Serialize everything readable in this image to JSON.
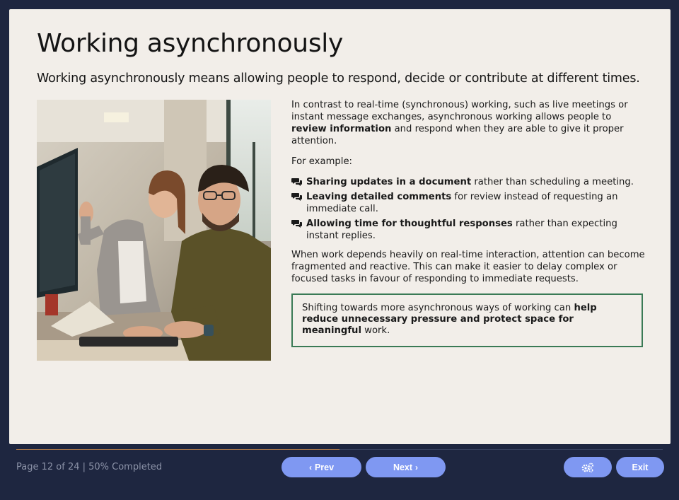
{
  "slide": {
    "title": "Working asynchronously",
    "subtitle": "Working asynchronously means allowing people to respond, decide or contribute at different times.",
    "photo_alt": "Two colleagues working together at a computer",
    "intro": {
      "pre": "In contrast to real-time (synchronous) working, such as live meetings or instant message exchanges, asynchronous working allows people to ",
      "bold": "review information",
      "post": " and respond when they are able to give it proper attention."
    },
    "example_label": "For example:",
    "bullets": [
      {
        "icon": "chat-bubbles-icon",
        "bold": "Sharing updates in a document",
        "text": " rather than scheduling a meeting."
      },
      {
        "icon": "chat-bubbles-icon",
        "bold": "Leaving detailed comments",
        "text": " for review instead of requesting an immediate call."
      },
      {
        "icon": "chat-bubbles-icon",
        "bold": "Allowing time for thoughtful responses",
        "text": " rather than expecting instant replies."
      }
    ],
    "closing": "When work depends heavily on real-time interaction, attention can become fragmented and reactive. This can make it easier to delay complex or focused tasks in favour of responding to immediate requests.",
    "callout": {
      "pre": "Shifting towards more asynchronous ways of working can ",
      "bold": "help reduce unnecessary pressure and protect space for meaningful",
      "post": " work."
    },
    "callout_border_color": "#3a7a55"
  },
  "footer": {
    "page_status": "Page 12 of 24 | 50% Completed",
    "progress_percent": 50,
    "prev_label": "Prev",
    "next_label": "Next",
    "settings_icon": "gears-icon",
    "exit_label": "Exit",
    "button_color": "#7f98f2",
    "progress_color": "#b07a4a"
  }
}
